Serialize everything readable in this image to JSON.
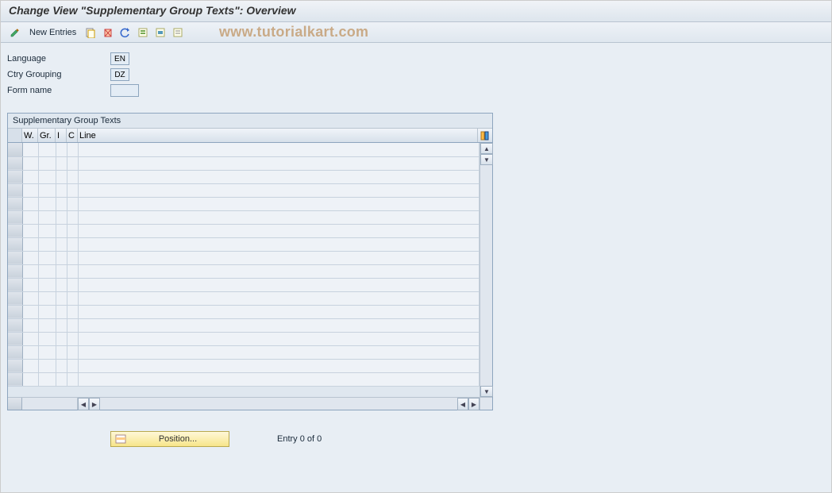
{
  "title": "Change View \"Supplementary Group Texts\": Overview",
  "watermark": "www.tutorialkart.com",
  "toolbar": {
    "new_entries_label": "New Entries"
  },
  "fields": {
    "language_label": "Language",
    "language_value": "EN",
    "ctry_label": "Ctry Grouping",
    "ctry_value": "DZ",
    "form_label": "Form name",
    "form_value": ""
  },
  "table": {
    "title": "Supplementary Group Texts",
    "cols": {
      "w": "W.",
      "gr": "Gr.",
      "i": "I",
      "c": "C",
      "line": "Line"
    }
  },
  "footer": {
    "position_label": "Position...",
    "entry_text": "Entry 0 of 0"
  }
}
